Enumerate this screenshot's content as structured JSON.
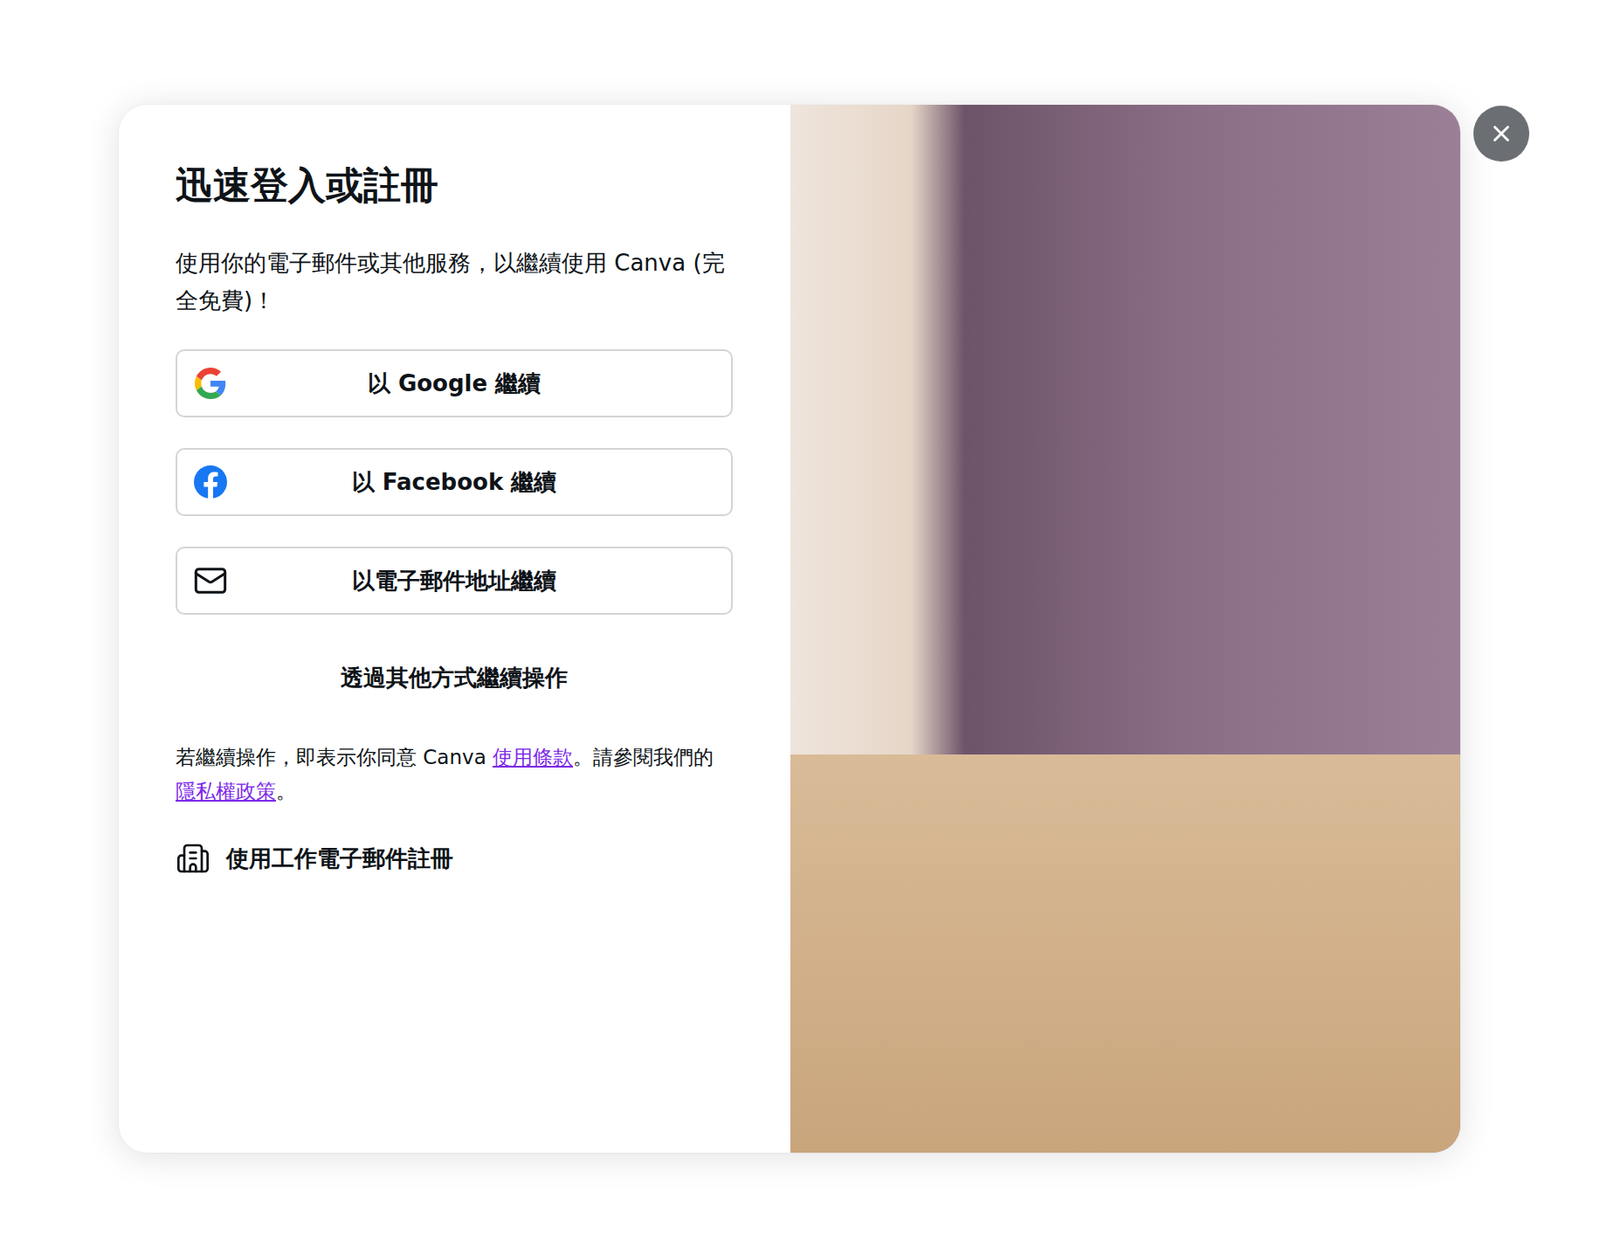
{
  "dialog": {
    "title": "迅速登入或註冊",
    "subtitle": "使用你的電子郵件或其他服務，以繼續使用 Canva (完全免費)！"
  },
  "buttons": [
    {
      "label": "以 Google 繼續",
      "kind": "google"
    },
    {
      "label": "以 Facebook 繼續",
      "kind": "facebook"
    },
    {
      "label": "以電子郵件地址繼續",
      "kind": "email"
    }
  ],
  "other_options": "透過其他方式繼續操作",
  "terms": {
    "prefix": "若繼續操作，即表示你同意 Canva ",
    "terms_link": "使用條款",
    "middle": "。請參閱我們的",
    "privacy_link": "隱私權政策",
    "suffix": "。"
  },
  "work_signup": "使用工作電子郵件註冊"
}
